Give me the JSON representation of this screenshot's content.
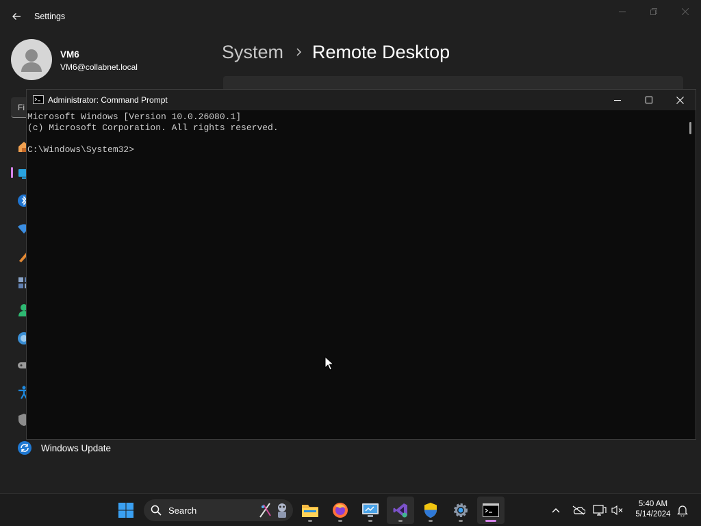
{
  "settings": {
    "window_title": "Settings",
    "user": {
      "name": "VM6",
      "email": "VM6@collabnet.local"
    },
    "breadcrumb": {
      "parent": "System",
      "separator_icon": "chevron-right-icon",
      "current": "Remote Desktop"
    },
    "search": {
      "placeholder": "Fi"
    },
    "nav_icons": [
      "home-icon",
      "system-icon",
      "bluetooth-icon",
      "network-icon",
      "personalization-icon",
      "apps-icon",
      "accounts-icon",
      "time-language-icon",
      "gaming-icon",
      "accessibility-icon",
      "privacy-security-icon"
    ],
    "nav_items": [
      {
        "label": "Windows Update",
        "icon": "windows-update-icon"
      }
    ]
  },
  "cmd": {
    "title": "Administrator: Command Prompt",
    "lines": [
      "Microsoft Windows [Version 10.0.26080.1]",
      "(c) Microsoft Corporation. All rights reserved.",
      "",
      "C:\\Windows\\System32>"
    ]
  },
  "taskbar": {
    "search_label": "Search",
    "apps": [
      "start-icon",
      "file-explorer-icon",
      "firefox-icon",
      "remote-desktop-connection-icon",
      "visual-studio-icon",
      "security-shield-icon",
      "settings-gear-icon",
      "command-prompt-icon"
    ],
    "active_app": "command-prompt-icon",
    "tray": [
      "chevron-up-icon",
      "onedrive-icon",
      "network-icon",
      "volume-muted-icon",
      "notifications-icon"
    ],
    "time": "5:40 AM",
    "date": "5/14/2024"
  },
  "colors": {
    "accent": "#d483e8",
    "windows_blue": "#0078d4",
    "console_text": "#cccccc",
    "console_bg": "#0c0c0c"
  }
}
